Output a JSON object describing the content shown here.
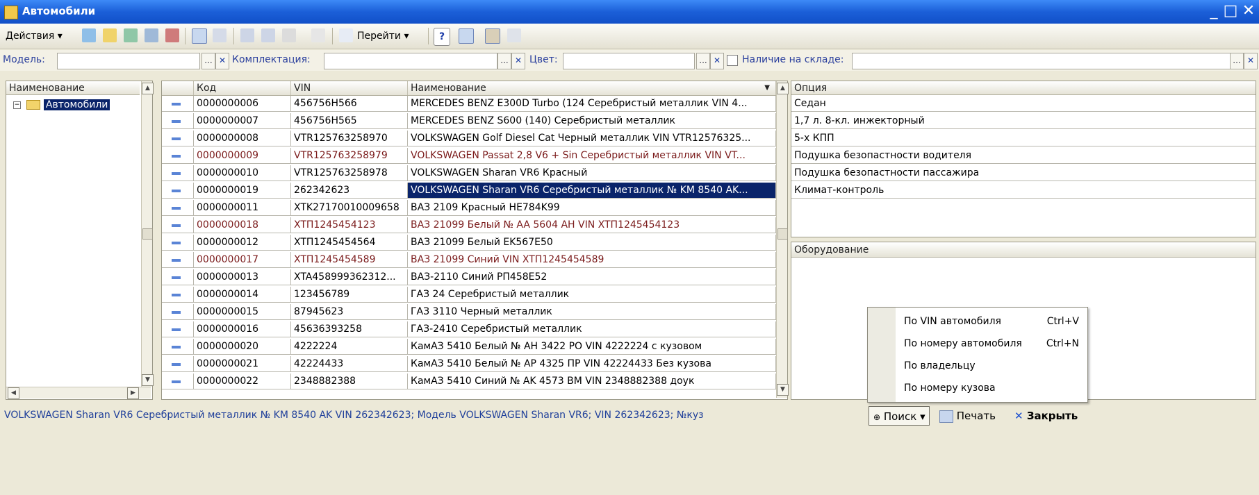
{
  "window": {
    "title": "Автомобили"
  },
  "toolbar": {
    "actions_label": "Действия",
    "goto_label": "Перейти",
    "help_label": "?"
  },
  "filters": {
    "model_label": "Модель:",
    "kit_label": "Комплектация:",
    "color_label": "Цвет:",
    "stock_label": "Наличие на складе:",
    "pick_label": "...",
    "clear_label": "✕"
  },
  "tree": {
    "header": "Наименование",
    "root_label": "Автомобили"
  },
  "grid": {
    "columns": [
      "Код",
      "VIN",
      "Наименование"
    ],
    "rows": [
      {
        "code": "0000000006",
        "vin": "456756H566",
        "name": "MERCEDES BENZ E300D Turbo (124 Серебристый металлик VIN 4..."
      },
      {
        "code": "0000000007",
        "vin": "456756H565",
        "name": "MERCEDES BENZ S600 (140) Серебристый металлик"
      },
      {
        "code": "0000000008",
        "vin": "VTR125763258970",
        "name": "VOLKSWAGEN Golf Diesel Cat Черный металлик VIN VTR12576325..."
      },
      {
        "code": "0000000009",
        "vin": "VTR125763258979",
        "name": "VOLKSWAGEN Passat 2,8 V6 + Sin Серебристый металлик VIN VT..."
      },
      {
        "code": "0000000010",
        "vin": "VTR125763258978",
        "name": "VOLKSWAGEN Sharan VR6 Красный"
      },
      {
        "code": "0000000019",
        "vin": "262342623",
        "name": "VOLKSWAGEN Sharan VR6 Серебристый металлик № KM 8540 AK..."
      },
      {
        "code": "0000000011",
        "vin": "XTK27170010009658",
        "name": "ВАЗ 2109 Красный HE784K99"
      },
      {
        "code": "0000000018",
        "vin": "XTП1245454123",
        "name": "ВАЗ 21099 Белый № AA 5604 AH VIN XTП1245454123"
      },
      {
        "code": "0000000012",
        "vin": "XTП1245454564",
        "name": "ВАЗ 21099 Белый EK567E50"
      },
      {
        "code": "0000000017",
        "vin": "XTП1245454589",
        "name": "ВАЗ 21099 Синий VIN XTП1245454589"
      },
      {
        "code": "0000000013",
        "vin": "XTA458999362312...",
        "name": "ВАЗ-2110 Синий РП458Е52"
      },
      {
        "code": "0000000014",
        "vin": "123456789",
        "name": "ГАЗ 24 Серебристый металлик"
      },
      {
        "code": "0000000015",
        "vin": "87945623",
        "name": "ГАЗ 3110 Черный металлик"
      },
      {
        "code": "0000000016",
        "vin": "45636393258",
        "name": "ГАЗ-2410 Серебристый металлик"
      },
      {
        "code": "0000000020",
        "vin": "4222224",
        "name": "КамАЗ 5410 Белый № AH 3422 PO VIN 4222224 с кузовом"
      },
      {
        "code": "0000000021",
        "vin": "42224433",
        "name": "КамАЗ 5410 Белый № AP 4325 ПР VIN 42224433 Без кузова"
      },
      {
        "code": "0000000022",
        "vin": "2348882388",
        "name": "КамАЗ 5410 Синий № AK 4573 BM VIN 2348882388 доук"
      }
    ]
  },
  "options": {
    "header": "Опция",
    "items": [
      "Седан",
      "1,7 л. 8-кл. инжекторный",
      "5-х КПП",
      "Подушка безопастности водителя",
      "Подушка безопастности пассажира",
      "Климат-контроль"
    ]
  },
  "equipment": {
    "header": "Оборудование"
  },
  "context_menu": {
    "items": [
      {
        "label": "По VIN автомобиля",
        "shortcut": "Ctrl+V"
      },
      {
        "label": "По номеру автомобиля",
        "shortcut": "Ctrl+N"
      },
      {
        "label": "По владельцу",
        "shortcut": ""
      },
      {
        "label": "По номеру кузова",
        "shortcut": ""
      }
    ]
  },
  "status": {
    "text": "VOLKSWAGEN Sharan VR6 Серебристый металлик № KM 8540 AK VIN 262342623; Модель VOLKSWAGEN Sharan VR6; VIN 262342623; №куз"
  },
  "buttons": {
    "search": "Поиск",
    "print": "Печать",
    "close": "Закрыть"
  },
  "colors": {
    "title_bar": "#1b5fd8",
    "selection": "#0a246a",
    "marked_text": "#7a1a1a",
    "label_blue": "#2a3f9d"
  }
}
